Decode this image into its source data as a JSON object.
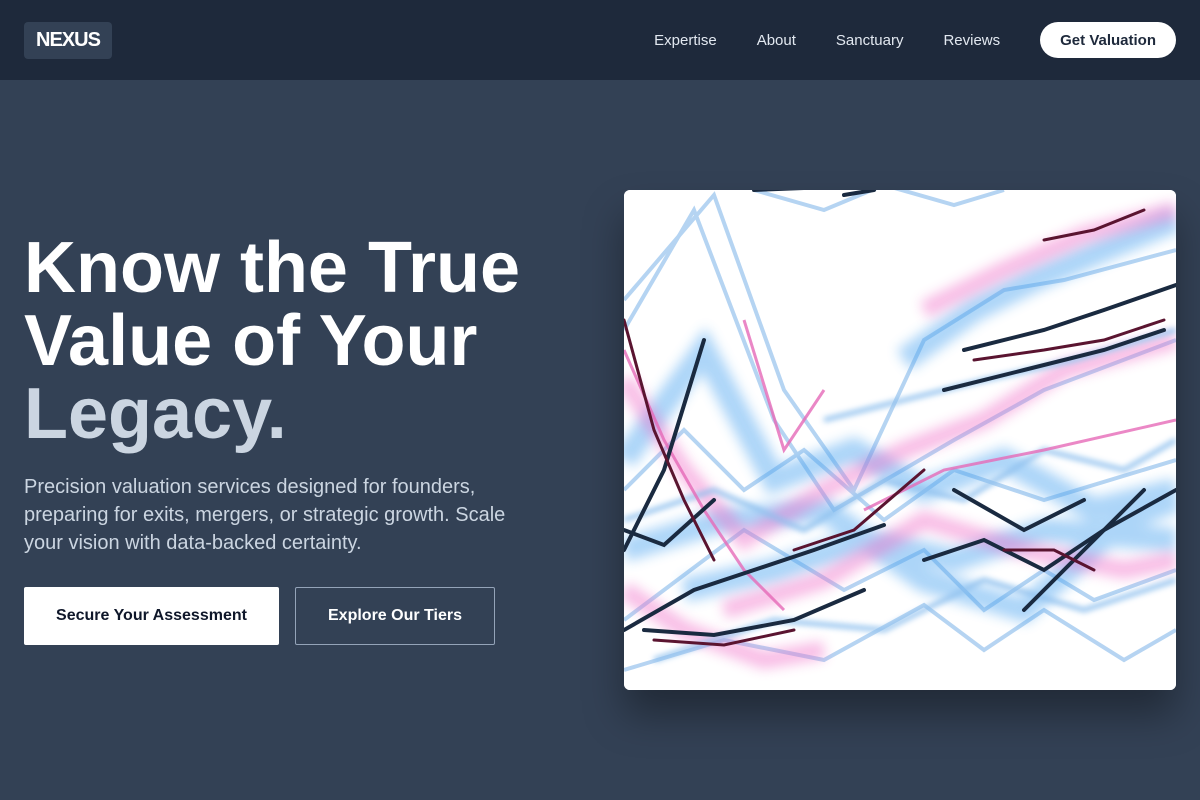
{
  "nav": {
    "logo": "NEXUS",
    "links": [
      "Expertise",
      "About",
      "Sanctuary",
      "Reviews"
    ],
    "cta_label": "Get Valuation"
  },
  "hero": {
    "headline_line1": "Know the True",
    "headline_line2": "Value of Your",
    "headline_accent": "Legacy.",
    "subhead": "Precision valuation services designed for founders, preparing for exits, mergers, or strategic growth. Scale your vision with data-backed certainty.",
    "primary_button": "Secure Your Assessment",
    "secondary_button": "Explore Our Tiers"
  },
  "colors": {
    "nav_bg": "#1e293b",
    "page_bg": "#334155",
    "accent_text": "#cbd5e1"
  }
}
